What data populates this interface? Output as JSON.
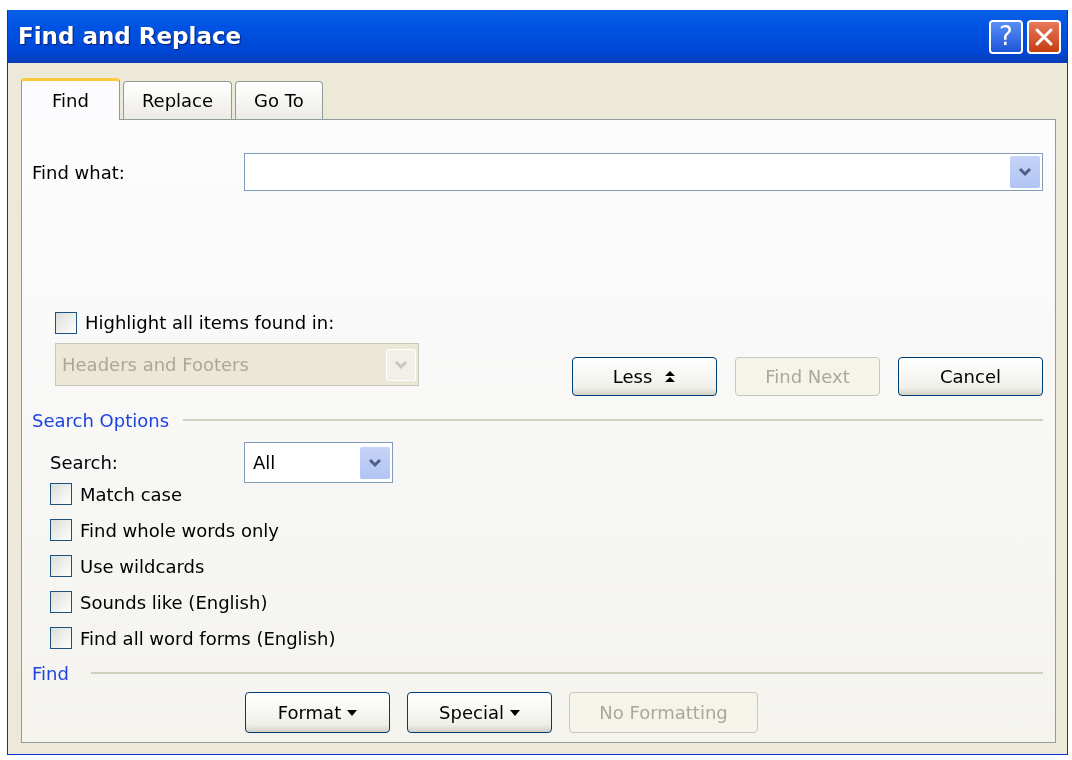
{
  "window": {
    "title": "Find and Replace",
    "help_button": "?"
  },
  "tabs": [
    {
      "label": "Find",
      "selected": true
    },
    {
      "label": "Replace",
      "selected": false
    },
    {
      "label": "Go To",
      "selected": false
    }
  ],
  "find_what": {
    "label": "Find what:"
  },
  "highlight": {
    "label": "Highlight all items found in:",
    "checked": false,
    "dropdown": {
      "value": "Headers and Footers",
      "disabled": true
    }
  },
  "buttons": [
    {
      "label": "Less",
      "kind": "collapse",
      "disabled": false
    },
    {
      "label": "Find Next",
      "kind": "plain",
      "disabled": true
    },
    {
      "label": "Cancel",
      "kind": "plain",
      "disabled": false
    }
  ],
  "search_options": {
    "title": "Search Options",
    "search_label": "Search:",
    "search_value": "All",
    "options": [
      {
        "label": "Match case",
        "checked": false
      },
      {
        "label": "Find whole words only",
        "checked": false
      },
      {
        "label": "Use wildcards",
        "checked": false
      },
      {
        "label": "Sounds like (English)",
        "checked": false
      },
      {
        "label": "Find all word forms (English)",
        "checked": false
      }
    ]
  },
  "find_section": {
    "title": "Find",
    "buttons": [
      {
        "label": "Format",
        "kind": "menu",
        "disabled": false
      },
      {
        "label": "Special",
        "kind": "menu",
        "disabled": false
      },
      {
        "label": "No Formatting",
        "kind": "plain",
        "disabled": true
      }
    ]
  }
}
